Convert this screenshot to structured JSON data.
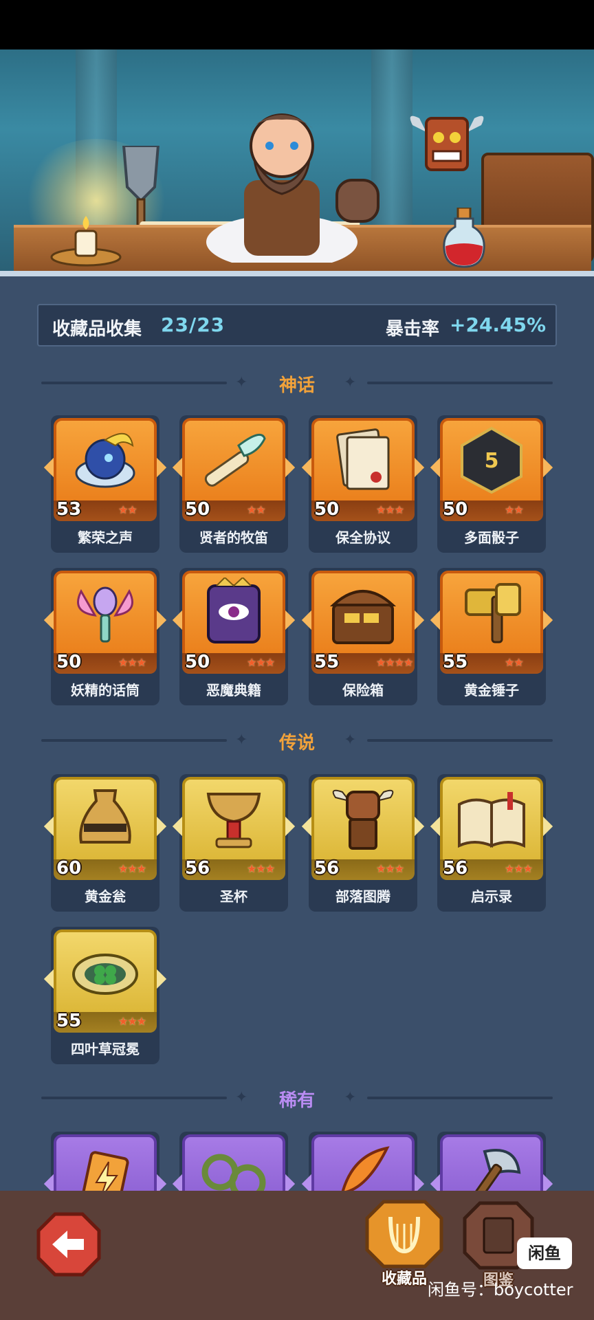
{
  "stats": {
    "collection_label": "收藏品收集",
    "collection_count": "23/23",
    "crit_label": "暴击率",
    "crit_value": "+24.45%"
  },
  "sections": {
    "mythic": "神话",
    "legendary": "传说",
    "rare": "稀有"
  },
  "mythic_items": [
    {
      "name": "繁荣之声",
      "level": "53"
    },
    {
      "name": "贤者的牧笛",
      "level": "50"
    },
    {
      "name": "保全协议",
      "level": "50"
    },
    {
      "name": "多面骰子",
      "level": "50"
    },
    {
      "name": "妖精的话筒",
      "level": "50"
    },
    {
      "name": "恶魔典籍",
      "level": "50"
    },
    {
      "name": "保险箱",
      "level": "55"
    },
    {
      "name": "黄金锤子",
      "level": "55"
    }
  ],
  "legendary_items": [
    {
      "name": "黄金瓮",
      "level": "60"
    },
    {
      "name": "圣杯",
      "level": "56"
    },
    {
      "name": "部落图腾",
      "level": "56"
    },
    {
      "name": "启示录",
      "level": "56"
    },
    {
      "name": "四叶草冠冕",
      "level": "55"
    }
  ],
  "rare_items": [
    {
      "icon": "lightning-card-icon"
    },
    {
      "icon": "thorn-shackles-icon"
    },
    {
      "icon": "flame-feather-icon"
    },
    {
      "icon": "stone-axe-icon"
    }
  ],
  "nav": {
    "collection_tab": "收藏品",
    "codex_tab": "图鉴"
  },
  "watermark": {
    "badge": "闲鱼",
    "text": "闲鱼号：boycotter"
  },
  "colors": {
    "mythic_title": "#f2a23a",
    "legendary_title": "#f2a23a",
    "rare_title": "#b98cf2",
    "accent_value": "#7fd7ee"
  }
}
